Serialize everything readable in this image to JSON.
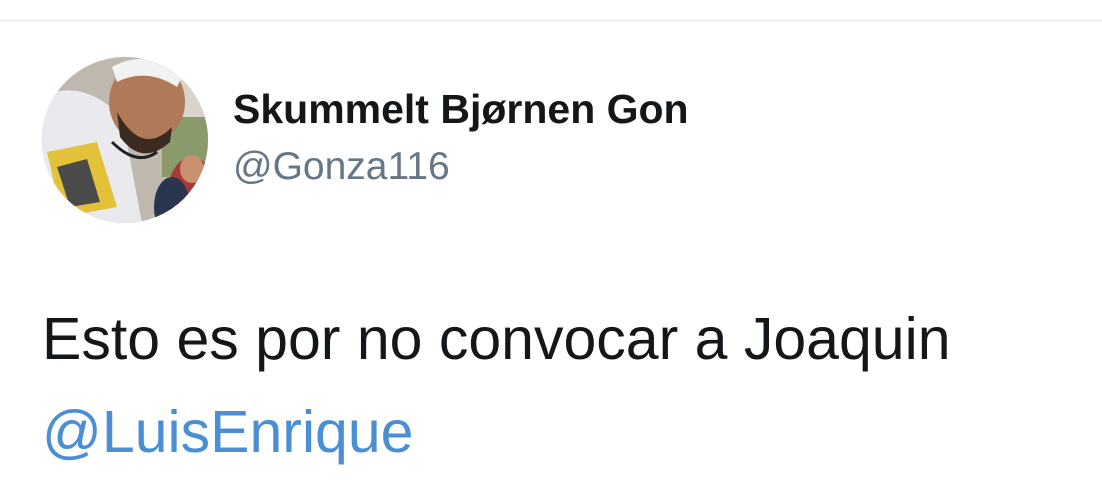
{
  "user": {
    "display_name": "Skummelt Bjørnen Gon",
    "handle": "@Gonza116"
  },
  "tweet": {
    "text": "Esto es por no convocar a Joaquin",
    "mention": "@LuisEnrique"
  },
  "colors": {
    "text": "#14171a",
    "handle": "#657786",
    "mention": "#4a8fd6",
    "divider": "#e1e8ed"
  }
}
